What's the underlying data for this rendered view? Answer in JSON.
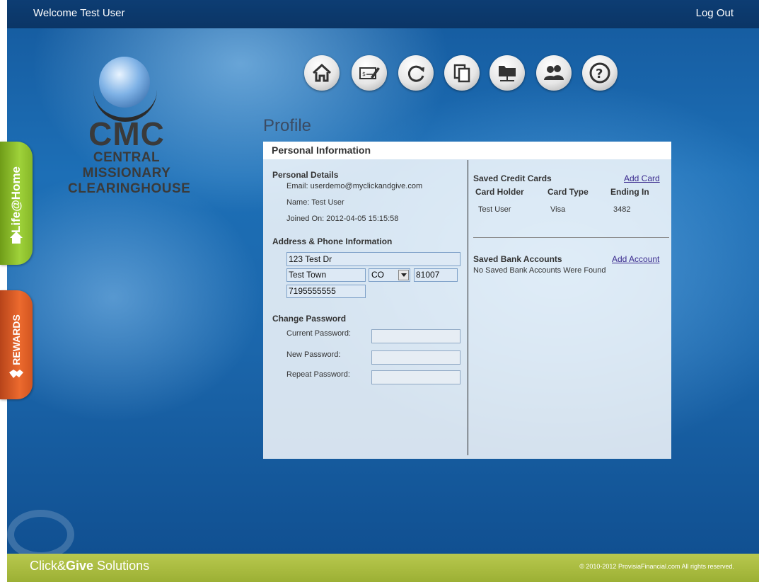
{
  "topbar": {
    "welcome": "Welcome Test User",
    "logout": "Log Out"
  },
  "logo": {
    "line1": "CMC",
    "line2": "CENTRAL",
    "line3": "MISSIONARY",
    "line4": "CLEARINGHOUSE"
  },
  "nav": [
    {
      "icon": "home-icon"
    },
    {
      "icon": "check-edit-icon"
    },
    {
      "icon": "recurring-icon"
    },
    {
      "icon": "documents-icon"
    },
    {
      "icon": "network-folder-icon"
    },
    {
      "icon": "users-icon"
    },
    {
      "icon": "help-icon"
    }
  ],
  "side_tabs": {
    "life": "Life@Home",
    "rewards": "REWARDS"
  },
  "page": {
    "title": "Profile",
    "panel_header": "Personal Information"
  },
  "personal_details": {
    "title": "Personal Details",
    "email": "Email: userdemo@myclickandgive.com",
    "name": "Name: Test User",
    "joined": "Joined On: 2012-04-05 15:15:58"
  },
  "address": {
    "title": "Address & Phone Information",
    "street": "123 Test Dr",
    "city": "Test Town",
    "state": "CO",
    "zip": "81007",
    "phone": "7195555555"
  },
  "password": {
    "title": "Change Password",
    "current_label": "Current Password:",
    "new_label": "New Password:",
    "repeat_label": "Repeat Password:",
    "current": "",
    "new": "",
    "repeat": ""
  },
  "cards": {
    "title": "Saved Credit Cards",
    "add_link": "Add Card",
    "headers": [
      "Card Holder",
      "Card Type",
      "Ending In"
    ],
    "rows": [
      {
        "holder": "Test User",
        "type": "Visa",
        "ending": "3482"
      }
    ]
  },
  "banks": {
    "title": "Saved Bank Accounts",
    "add_link": "Add Account",
    "empty": "No Saved Bank Accounts Were Found"
  },
  "footer": {
    "brand_pre": "Click&",
    "brand_bold": "Give",
    "brand_post": " Solutions",
    "copyright": "© 2010-2012 ProvisiaFinancial.com   All rights reserved."
  }
}
